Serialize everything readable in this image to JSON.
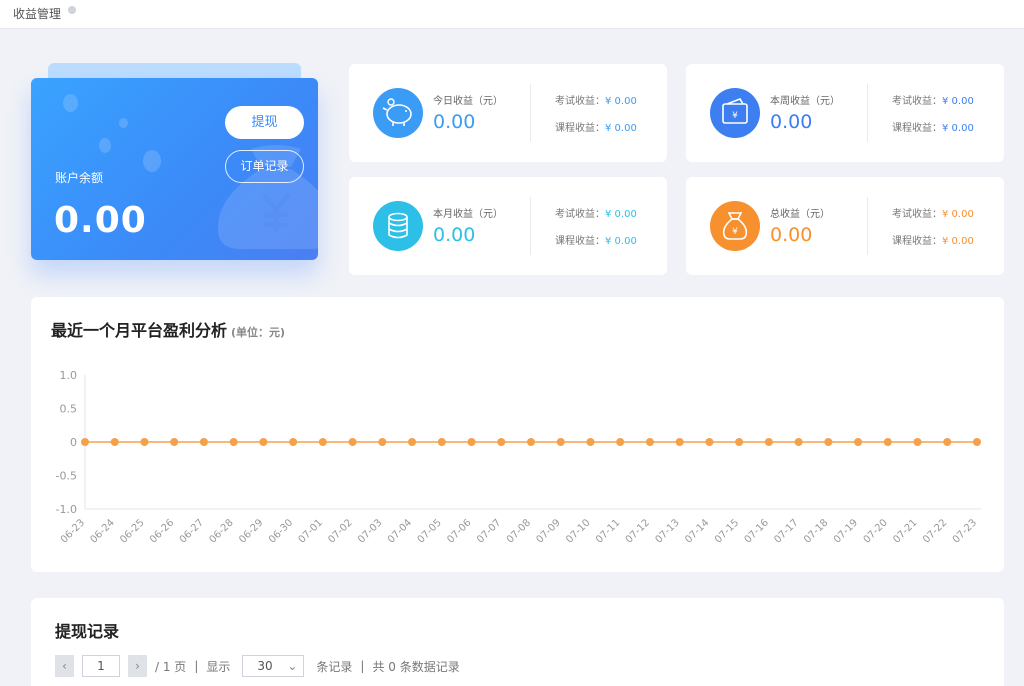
{
  "topbar": {
    "title": "收益管理"
  },
  "balance": {
    "label": "账户余额",
    "amount": "0.00",
    "withdraw_label": "提现",
    "orders_label": "订单记录"
  },
  "stats": {
    "today": {
      "caption": "今日收益（元）",
      "value": "0.00",
      "exam_label": "考试收益：",
      "exam_value": "¥ 0.00",
      "course_label": "课程收益：",
      "course_value": "¥ 0.00",
      "color": "#3b9cf5",
      "icon": "piggy-bank-icon"
    },
    "week": {
      "caption": "本周收益（元）",
      "value": "0.00",
      "exam_label": "考试收益：",
      "exam_value": "¥ 0.00",
      "course_label": "课程收益：",
      "course_value": "¥ 0.00",
      "color": "#3d7ff0",
      "icon": "wallet-icon"
    },
    "month": {
      "caption": "本月收益（元）",
      "value": "0.00",
      "exam_label": "考试收益：",
      "exam_value": "¥ 0.00",
      "course_label": "课程收益：",
      "course_value": "¥ 0.00",
      "color": "#2dbfe7",
      "icon": "coins-icon"
    },
    "total": {
      "caption": "总收益（元）",
      "value": "0.00",
      "exam_label": "考试收益：",
      "exam_value": "¥ 0.00",
      "course_label": "课程收益：",
      "course_value": "¥ 0.00",
      "color": "#f7902e",
      "icon": "money-bag-icon"
    }
  },
  "chart_panel": {
    "title": "最近一个月平台盈利分析",
    "unit": "(单位：元)"
  },
  "chart_data": {
    "type": "line",
    "categories": [
      "06-23",
      "06-24",
      "06-25",
      "06-26",
      "06-27",
      "06-28",
      "06-29",
      "06-30",
      "07-01",
      "07-02",
      "07-03",
      "07-04",
      "07-05",
      "07-06",
      "07-07",
      "07-08",
      "07-09",
      "07-10",
      "07-11",
      "07-12",
      "07-13",
      "07-14",
      "07-15",
      "07-16",
      "07-17",
      "07-18",
      "07-19",
      "07-20",
      "07-21",
      "07-22",
      "07-23"
    ],
    "series": [
      {
        "values": [
          0,
          0,
          0,
          0,
          0,
          0,
          0,
          0,
          0,
          0,
          0,
          0,
          0,
          0,
          0,
          0,
          0,
          0,
          0,
          0,
          0,
          0,
          0,
          0,
          0,
          0,
          0,
          0,
          0,
          0,
          0
        ],
        "color": "#f5a04a"
      }
    ],
    "yticks": [
      "1.0",
      "0.5",
      "0",
      "-0.5",
      "-1.0"
    ],
    "ylim": [
      -1,
      1
    ],
    "grid": false,
    "title": "",
    "xlabel": "",
    "ylabel": ""
  },
  "records": {
    "title": "提现记录",
    "prev_icon": "chevron-left-icon",
    "next_icon": "chevron-right-icon",
    "page_value": "1",
    "page_total": "/ 1 页",
    "sep": "|",
    "show_label": "显示",
    "page_size": "30",
    "per_label": "条记录",
    "total_label": "共 0 条数据记录"
  }
}
